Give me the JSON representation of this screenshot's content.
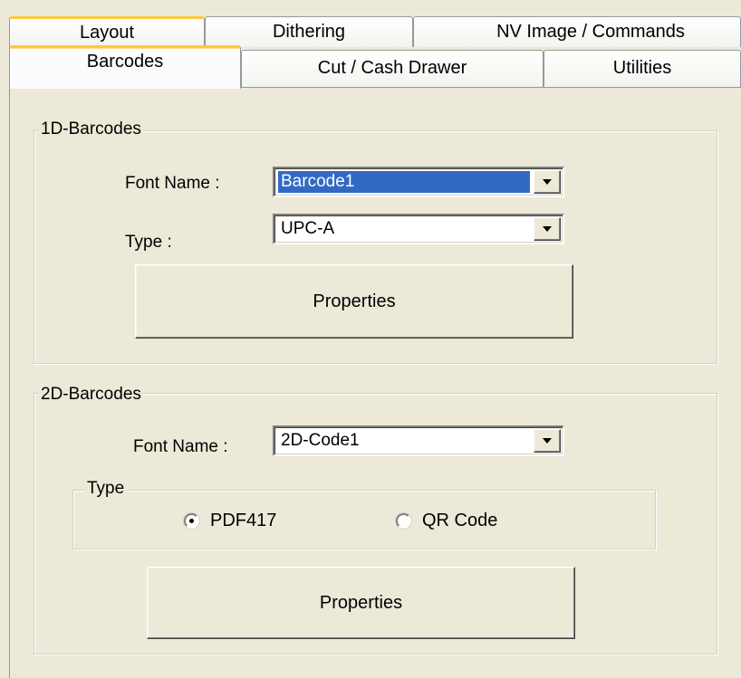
{
  "tabs": {
    "row1": [
      {
        "label": "Layout"
      },
      {
        "label": "Dithering"
      },
      {
        "label": "NV Image / Commands"
      }
    ],
    "row2": [
      {
        "label": "Barcodes"
      },
      {
        "label": "Cut / Cash Drawer"
      },
      {
        "label": "Utilities"
      }
    ],
    "active_tab": "Barcodes"
  },
  "barcode_1d": {
    "group_title": "1D-Barcodes",
    "font_name_label": "Font Name :",
    "font_name_value": "Barcode1",
    "type_label": "Type :",
    "type_value": "UPC-A",
    "properties_label": "Properties"
  },
  "barcode_2d": {
    "group_title": "2D-Barcodes",
    "font_name_label": "Font Name :",
    "font_name_value": "2D-Code1",
    "type_group_title": "Type",
    "radio_options": [
      {
        "label": "PDF417",
        "checked": true
      },
      {
        "label": "QR Code",
        "checked": false
      }
    ],
    "properties_label": "Properties"
  },
  "icons": {
    "dropdown": "chevron-down-icon",
    "radio": "radio-icon"
  },
  "colors": {
    "background": "#ece9d8",
    "selection": "#316ac5",
    "active_tab_accent": "#ffc83c"
  }
}
